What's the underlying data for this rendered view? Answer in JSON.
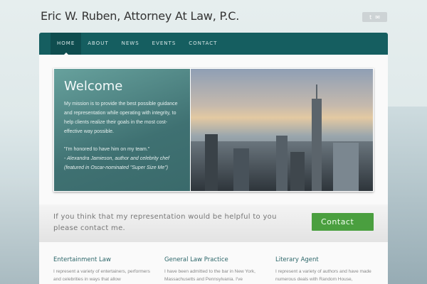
{
  "site": {
    "title": "Eric W. Ruben, Attorney At Law, P.C."
  },
  "social": [
    {
      "icon": "twitter-icon",
      "glyph": "t"
    },
    {
      "icon": "email-icon",
      "glyph": "✉"
    }
  ],
  "nav": [
    {
      "label": "HOME",
      "active": true
    },
    {
      "label": "ABOUT"
    },
    {
      "label": "NEWS"
    },
    {
      "label": "EVENTS"
    },
    {
      "label": "CONTACT"
    }
  ],
  "welcome": {
    "heading": "Welcome",
    "mission": "My mission is to provide the best possible guidance and representation while operating with integrity, to help clients realize their goals in the most cost-effective way possible.",
    "quote": "\"I'm honored to have him on my team.\"",
    "attribution": "- Alexandra Jamieson, author and celebrity chef",
    "attribution2": "(featured in Oscar-nominated \"Super Size Me\")"
  },
  "cta": {
    "text": "If you think that my representation would be helpful to you please contact me.",
    "button": "Contact"
  },
  "columns": [
    {
      "title": "Entertainment Law",
      "text": "I represent a variety of entertainers, performers and celebrities in ways that allow"
    },
    {
      "title": "General Law Practice",
      "text": "I have been admitted to the bar in New York, Massachusetts and Pennsylvania. I've"
    },
    {
      "title": "Literary Agent",
      "text": "I represent a variety of authors and have made numerous deals with Random House,"
    }
  ]
}
